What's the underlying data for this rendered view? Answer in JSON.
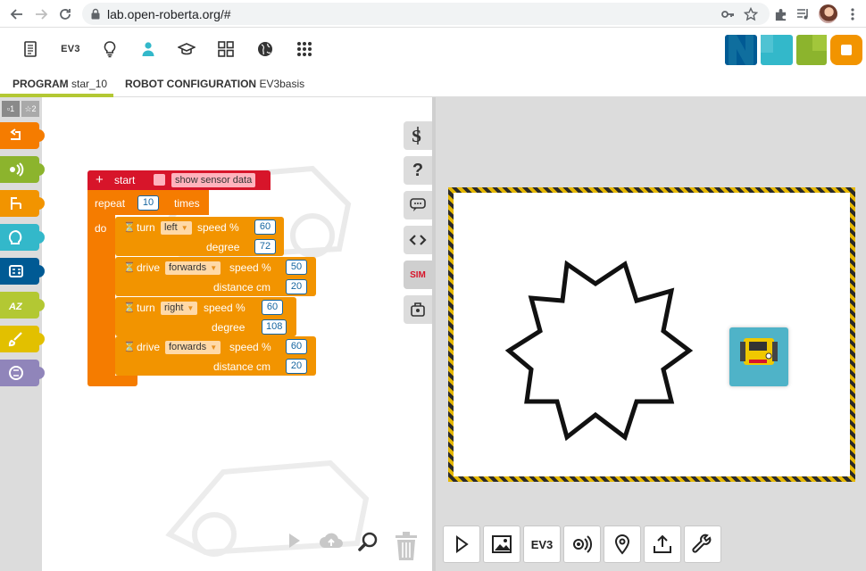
{
  "browser": {
    "url": "lab.open-roberta.org/#",
    "back_icon": "arrow-left-icon",
    "forward_icon": "arrow-right-icon",
    "reload_icon": "reload-icon"
  },
  "header": {
    "ev3_label": "EV3",
    "icons": [
      "file-icon",
      "ev3-icon",
      "lightbulb-icon",
      "user-icon",
      "graduation-cap-icon",
      "grid-icon",
      "globe-icon",
      "apps-icon"
    ]
  },
  "tabs": {
    "program": {
      "label": "PROGRAM",
      "value": "star_10"
    },
    "config": {
      "label": "ROBOT CONFIGURATION",
      "value": "EV3basis"
    }
  },
  "toolbox": {
    "levels": [
      "1",
      "2"
    ],
    "categories": [
      {
        "name": "action",
        "color": "#f57c00"
      },
      {
        "name": "sensors",
        "color": "#8cb42d"
      },
      {
        "name": "control",
        "color": "#f29400"
      },
      {
        "name": "logic",
        "color": "#33b8ca"
      },
      {
        "name": "math",
        "color": "#005a94"
      },
      {
        "name": "text",
        "color": "#b3c833"
      },
      {
        "name": "colours",
        "color": "#e2c000"
      },
      {
        "name": "variables",
        "color": "#9085ba"
      }
    ]
  },
  "program": {
    "start_label": "start",
    "show_sensor_label": "show sensor data",
    "repeat_label": "repeat",
    "repeat_count": "10",
    "times_label": "times",
    "do_label": "do",
    "blocks": [
      {
        "verb": "turn",
        "dir": "left",
        "speed_label": "speed %",
        "speed": "60",
        "second_label": "degree",
        "second": "72"
      },
      {
        "verb": "drive",
        "dir": "forwards",
        "speed_label": "speed %",
        "speed": "50",
        "second_label": "distance cm",
        "second": "20"
      },
      {
        "verb": "turn",
        "dir": "right",
        "speed_label": "speed %",
        "speed": "60",
        "second_label": "degree",
        "second": "108"
      },
      {
        "verb": "drive",
        "dir": "forwards",
        "speed_label": "speed %",
        "speed": "60",
        "second_label": "distance cm",
        "second": "20"
      }
    ]
  },
  "side_rail": {
    "sim_label": "SIM",
    "help_label": "?"
  },
  "sim_toolbar": {
    "ev3_label": "EV3"
  }
}
